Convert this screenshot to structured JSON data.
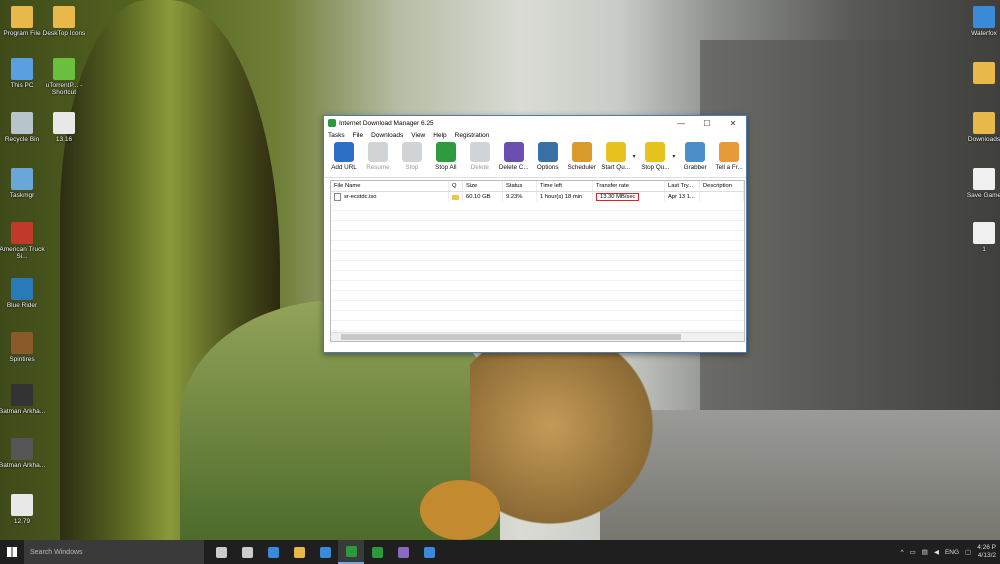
{
  "desktop": {
    "left_icons": [
      {
        "label": "Program File",
        "color": "#e8b94a"
      },
      {
        "label": "DeskTop Icons",
        "color": "#e8b94a"
      },
      {
        "label": "This PC",
        "color": "#5aa0e0"
      },
      {
        "label": "uTorrentP... - Shortcut",
        "color": "#6ac03c"
      },
      {
        "label": "Recycle Bin",
        "color": "#b8c4cc"
      },
      {
        "label": "13.16",
        "color": "#e8e8e8"
      },
      {
        "label": "Taskmgr",
        "color": "#6aa6d8"
      },
      {
        "label": "American Truck Si...",
        "color": "#c0392b"
      },
      {
        "label": "Blue Rider",
        "color": "#2a7ab8"
      },
      {
        "label": "Spintires",
        "color": "#8a5a2a"
      },
      {
        "label": "Batman Arkha...",
        "color": "#333333"
      },
      {
        "label": "Batman Arkha...",
        "color": "#555555"
      },
      {
        "label": "12.79",
        "color": "#e8e8e8"
      }
    ],
    "right_icons": [
      {
        "label": "Waterfox",
        "color": "#3a8ad8"
      },
      {
        "label": "",
        "color": "#e8b94a"
      },
      {
        "label": "Downloads",
        "color": "#e8b94a"
      },
      {
        "label": "Save Game",
        "color": "#f0f0f0"
      },
      {
        "label": "1",
        "color": "#f0f0f0"
      }
    ]
  },
  "window": {
    "title": "Internet Download Manager 6.25",
    "controls": {
      "minimize": "—",
      "maximize": "☐",
      "close": "✕"
    },
    "menu": [
      "Tasks",
      "File",
      "Downloads",
      "View",
      "Help",
      "Registration"
    ],
    "toolbar": [
      {
        "label": "Add URL",
        "icon": "add-url-icon",
        "color": "#2d6fc4",
        "disabled": false
      },
      {
        "label": "Resume",
        "icon": "resume-icon",
        "color": "#9aa0a6",
        "disabled": true
      },
      {
        "label": "Stop",
        "icon": "stop-icon",
        "color": "#9aa0a6",
        "disabled": true
      },
      {
        "label": "Stop All",
        "icon": "stop-all-icon",
        "color": "#2e9c3e",
        "disabled": false
      },
      {
        "label": "Delete",
        "icon": "delete-icon",
        "color": "#9aa0a6",
        "disabled": true
      },
      {
        "label": "Delete C...",
        "icon": "delete-completed-icon",
        "color": "#6a4fb0",
        "disabled": false
      },
      {
        "label": "Options",
        "icon": "options-icon",
        "color": "#3a6fa8",
        "disabled": false
      },
      {
        "label": "Scheduler",
        "icon": "scheduler-icon",
        "color": "#d89a2a",
        "disabled": false
      },
      {
        "label": "Start Qu...",
        "icon": "start-queue-icon",
        "color": "#e6c21f",
        "disabled": false
      },
      {
        "label": "Stop Qu...",
        "icon": "stop-queue-icon",
        "color": "#e6c21f",
        "disabled": false
      },
      {
        "label": "Grabber",
        "icon": "grabber-icon",
        "color": "#4a8fc8",
        "disabled": false
      },
      {
        "label": "Tell a Fr...",
        "icon": "tell-a-friend-icon",
        "color": "#e69a3a",
        "disabled": false
      }
    ],
    "columns": [
      "File Name",
      "Q",
      "Size",
      "Status",
      "Time left",
      "Transfer rate",
      "Last Try...",
      "Description"
    ],
    "rows": [
      {
        "file_name": "sr-ecstdc.iso",
        "q": "",
        "size": "60.10 GB",
        "status": "9.23%",
        "time_left": "1 hour(s) 18 min",
        "transfer_rate": "13.30 MB/sec",
        "last_try": "Apr 13 1...",
        "description": ""
      }
    ]
  },
  "taskbar": {
    "search_placeholder": "Search Windows",
    "apps": [
      {
        "name": "task-view-icon",
        "color": "#cccccc"
      },
      {
        "name": "store-icon",
        "color": "#cccccc"
      },
      {
        "name": "edge-icon",
        "color": "#3a8ad8"
      },
      {
        "name": "file-explorer-icon",
        "color": "#e8b94a"
      },
      {
        "name": "ie-icon",
        "color": "#3a8ad8"
      },
      {
        "name": "idm-icon",
        "color": "#2c9a3c"
      },
      {
        "name": "app-green-icon",
        "color": "#2c9a3c"
      },
      {
        "name": "app-purple-icon",
        "color": "#8a6ac0"
      },
      {
        "name": "waterfox-icon",
        "color": "#3a8ad8"
      }
    ],
    "tray": {
      "chevron": "^",
      "language": "ENG",
      "time": "4:26 P",
      "date": "4/13/2"
    }
  }
}
